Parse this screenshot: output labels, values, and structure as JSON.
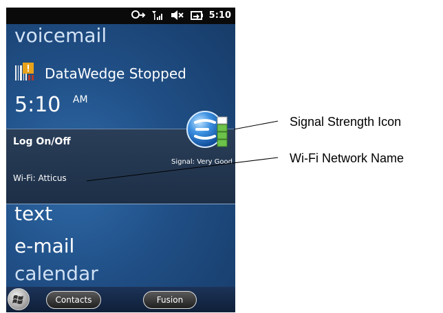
{
  "status_bar": {
    "time": "5:10",
    "icons": [
      "sync-icon",
      "signal-bars-icon",
      "speaker-muted-icon",
      "battery-charging-icon"
    ]
  },
  "home": {
    "voicemail": "voicemail",
    "datawedge": "DataWedge Stopped",
    "time": "5:10",
    "ampm": "AM",
    "panel": {
      "title": "Log On/Off",
      "signal": "Signal: Very Good",
      "wifi": "Wi-Fi: Atticus"
    },
    "tiles": [
      "text",
      "e-mail",
      "calendar"
    ]
  },
  "taskbar": {
    "contacts": "Contacts",
    "fusion": "Fusion"
  },
  "annotations": {
    "signal_icon": "Signal Strength Icon",
    "wifi_name": "Wi-Fi Network Name"
  },
  "colors": {
    "background": "#204f86",
    "panel": "#2a3e58",
    "signal_green": "#6cc24a",
    "accent": "#3b8fe0"
  }
}
